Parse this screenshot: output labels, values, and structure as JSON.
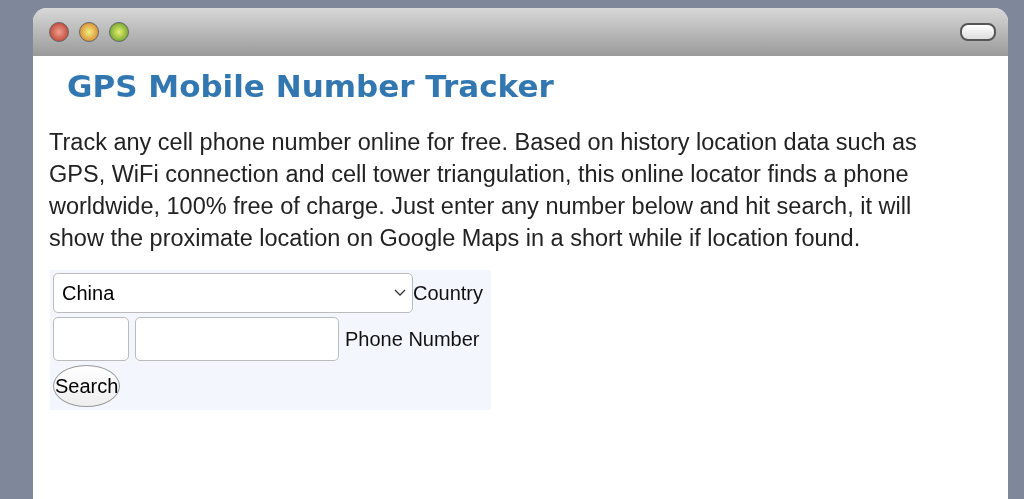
{
  "window": {
    "controls": [
      {
        "kind": "close"
      },
      {
        "kind": "minimize"
      },
      {
        "kind": "zoom"
      }
    ]
  },
  "title": "GPS Mobile Number Tracker",
  "description": "Track any cell phone number online for free. Based on history location data such as GPS, WiFi connection and cell tower triangulation, this online locator finds a phone worldwide, 100% free of charge. Just enter any number below and hit search, it will show the proximate location on Google Maps in a short while if location found.",
  "form": {
    "country": {
      "value": "China",
      "label": "Country"
    },
    "phone_label": "Phone Number",
    "search_button": "Search"
  }
}
